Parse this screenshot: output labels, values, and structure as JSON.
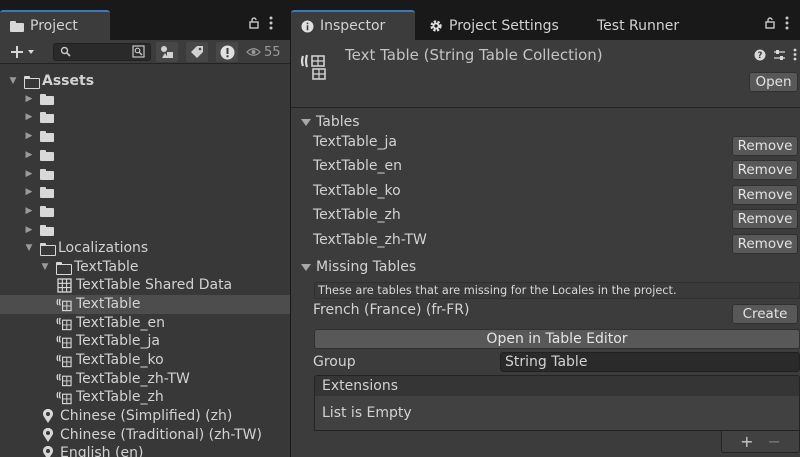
{
  "project_window": {
    "tab_label": "Project",
    "search": {
      "value": "",
      "placeholder": ""
    },
    "hidden_count": "55",
    "tree": [
      {
        "label": "Assets",
        "bold": true
      },
      {
        "label": ""
      },
      {
        "label": ""
      },
      {
        "label": ""
      },
      {
        "label": ""
      },
      {
        "label": ""
      },
      {
        "label": ""
      },
      {
        "label": ""
      },
      {
        "label": ""
      },
      {
        "label": "Localizations"
      },
      {
        "label": "TextTable"
      },
      {
        "label": "TextTable Shared Data"
      },
      {
        "label": "TextTable"
      },
      {
        "label": "TextTable_en"
      },
      {
        "label": "TextTable_ja"
      },
      {
        "label": "TextTable_ko"
      },
      {
        "label": "TextTable_zh-TW"
      },
      {
        "label": "TextTable_zh"
      },
      {
        "label": "Chinese (Simplified) (zh)"
      },
      {
        "label": "Chinese (Traditional) (zh-TW)"
      },
      {
        "label": "English (en)"
      }
    ]
  },
  "inspector": {
    "tabs": [
      "Inspector",
      "Project Settings",
      "Test Runner"
    ],
    "title": "Text Table (String Table Collection)",
    "open_button": "Open",
    "tables_section": {
      "label": "Tables",
      "items": [
        "TextTable_ja",
        "TextTable_en",
        "TextTable_ko",
        "TextTable_zh",
        "TextTable_zh-TW"
      ],
      "remove_label": "Remove"
    },
    "missing_section": {
      "label": "Missing Tables",
      "note": "These are tables that are missing for the Locales in the project.",
      "items": [
        "French (France) (fr-FR)"
      ],
      "create_label": "Create"
    },
    "open_in_editor": "Open in Table Editor",
    "group_label": "Group",
    "group_value": "String Table",
    "extensions_label": "Extensions",
    "list_empty": "List is Empty",
    "add_glyph": "+",
    "remove_glyph": "−"
  },
  "colors": {
    "accent": "#3a79bb",
    "panel": "#383838",
    "inspector_bg": "#3c3c3c",
    "selected_row": "#4d4d4d"
  }
}
